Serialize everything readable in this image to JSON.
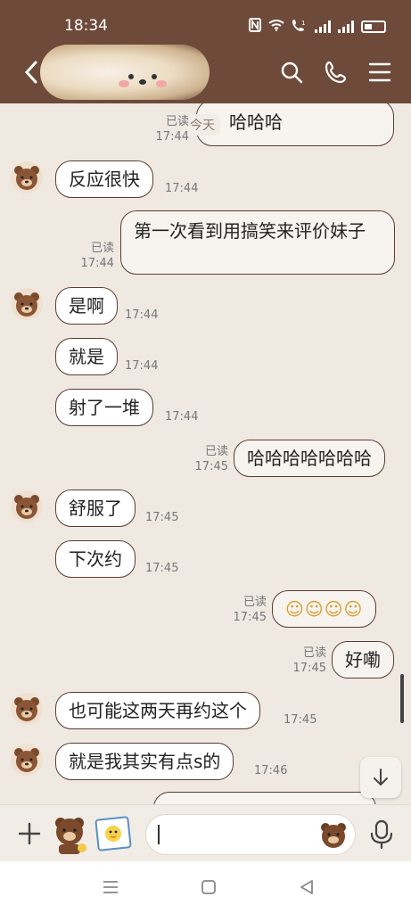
{
  "status_bar": {
    "time": "18:34",
    "icons": [
      "nfc-icon",
      "wifi-icon",
      "call-icon",
      "signal-icon",
      "signal-icon",
      "battery-icon"
    ]
  },
  "header": {
    "back_icon": "chevron-left-icon",
    "actions": [
      "search-icon",
      "phone-icon",
      "menu-icon"
    ]
  },
  "date_chip": "今天",
  "read_label": "已读",
  "messages": [
    {
      "side": "right",
      "text": "哈哈哈",
      "time": "17:44",
      "read": true
    },
    {
      "side": "left",
      "text": "反应很快",
      "time": "17:44"
    },
    {
      "side": "right",
      "text": "第一次看到用搞笑来评价妹子",
      "time": "17:44",
      "read": true
    },
    {
      "side": "left",
      "text": "是啊",
      "time": "17:44"
    },
    {
      "side": "left",
      "text": "就是",
      "time": "17:44"
    },
    {
      "side": "left",
      "text": "射了一堆",
      "time": "17:44"
    },
    {
      "side": "right",
      "text": "哈哈哈哈哈哈哈",
      "time": "17:45",
      "read": true
    },
    {
      "side": "left",
      "text": "舒服了",
      "time": "17:45"
    },
    {
      "side": "left",
      "text": "下次约",
      "time": "17:45"
    },
    {
      "side": "right",
      "text": "☺☺☺☺",
      "time": "17:45",
      "read": true
    },
    {
      "side": "right",
      "text": "好嘞",
      "time": "17:45",
      "read": true
    },
    {
      "side": "left",
      "text": "也可能这两天再约这个",
      "time": "17:45"
    },
    {
      "side": "left",
      "text": "就是我其实有点s的",
      "time": "17:46"
    }
  ],
  "input": {
    "placeholder": "",
    "value": ""
  },
  "colors": {
    "header_bg": "#6e4a3a",
    "chat_bg": "#efe9e2",
    "bubble_border": "#5a3d30"
  }
}
